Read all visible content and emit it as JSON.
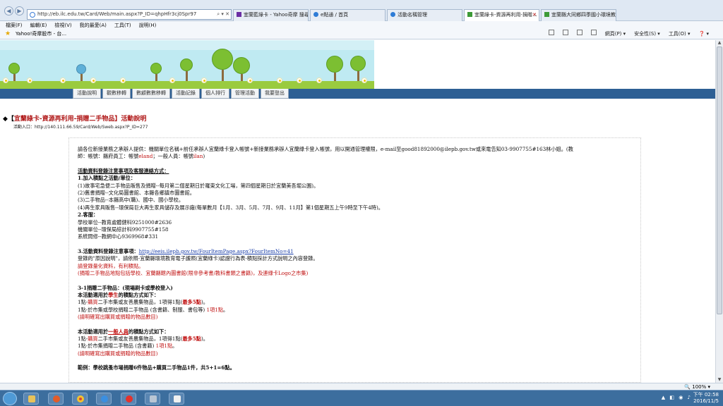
{
  "browser": {
    "url": "http://eb.ilc.edu.tw/Card/Web/main.aspx?P_ID=qhpHfr3cj0Spr97",
    "tabs": [
      {
        "label": "宜蘭藍綠卡 - Yahoo奇摩 搜尋...",
        "active": false
      },
      {
        "label": "e點通 / 首頁",
        "active": false
      },
      {
        "label": "活動名稱管理",
        "active": false
      },
      {
        "label": "宜蘭綠卡-資源再利用-捐贈...",
        "active": true
      },
      {
        "label": "宜蘭縣大同鄉四季國小環境教...",
        "active": false
      }
    ],
    "menu": [
      "檔案(F)",
      "編輯(E)",
      "檢視(V)",
      "我的最愛(A)",
      "工具(T)",
      "說明(H)"
    ],
    "favorites_link": "Yahoo!奇摩股市 - 台...",
    "command_bar": [
      "網頁(P) ▾",
      "安全性(S) ▾",
      "工具(O) ▾",
      "❓ ▾"
    ],
    "zoom": "🔍 100% ▾"
  },
  "site_nav": [
    "活動說明",
    "觀數移轉",
    "數顧數數移轉",
    "活動記錄",
    "個人排行",
    "管理活動",
    "我要登出"
  ],
  "page": {
    "heading_prefix": "◆【",
    "heading_title": "宜蘭綠卡-資源再利用-捐贈二手物品",
    "heading_suffix": "】活動說明",
    "entry": "活動入口：http://140.111.66.59/Card/Web/Sweb.aspx?P_ID=277",
    "intro_1": "請各位新接業務之承辦人提供：機關單位名稱+前任承辦人宜蘭綠卡登入帳號+新接業務承辦人宜蘭綠卡登入帳號，用以開通管理權限，e-mail至good81892000@ilepb.gov.tw或來電告知03-9907755#163林小姐。(教",
    "intro_2a": "師：帳號：縣府員工：帳號",
    "intro_2b": "eland",
    "intro_2c": "；一般人員：帳號",
    "intro_2d": "ilan",
    "intro_2e": ")",
    "reg_title": "活動資料登錄注意事項及客服連絡方式：",
    "s1_title": "1.加入積點之活動/單位：",
    "s1_items": [
      "(1)故事宅急便二手物品販售及捐贈--每月第二個星期日於羅東文化工場，第四個星期日於宜蘭美吾堀公園)。",
      "(2)舊書捐贈--文化局圖書館、本縣各鄉鎮市圖書館。",
      "(3)二手物品--本縣高中(職)、國中、國小學校。",
      "(4)再生家具販售--環保局巨大再生家具儲存及展示廠(每單數月【1月、3月、5月、7月、9月、11月】第1個星期五上午9時至下午4時)。"
    ],
    "s2_title": "2.客服：",
    "s2_items": [
      "學校單位--教育處體健科9251000#2636",
      "機關單位--環保局綜計科9907755#158",
      "系統問修--教網中心9369968#331"
    ],
    "s3_title": "3.活動資料登錄注意事項：",
    "s3_link": "http://eeis.ilepb.gov.tw/FourItemPage.aspx?FourItemNo=41",
    "s3_line1": "登錄的\"原因說明\"，請依照-宜蘭縣環境教育電子護照(宜蘭綠卡)認證行為表-積點採計方式說明之內容登錄。",
    "s3_line2": "請登錄量化資料，有利積點。",
    "s3_line3": "(捐贈二手物品地點包括學校、宜蘭縣轄內圖書館(限非參考書/教科書類之書籍)，及連綠卡Logo之市集)",
    "s31_title": "3-1捐贈二手物品：(現場刷卡或學校登入)",
    "student_a": "本活動適用於",
    "student_b": "學生",
    "student_c": "的積點方式如下：",
    "st1_a": "1點-",
    "st1_b": "購買",
    "st1_c": "二手市集或友善農集物品，1項得1點(",
    "st1_d": "最多5點",
    "st1_e": ")。",
    "st2_a": "1點-於市集或學校捐贈二手物品 (含書籍、制服、書包等) ",
    "st2_b": "1項1點",
    "st2_c": "。",
    "st_note": "(請明確寫出購買或捐贈的物品數目)",
    "general_a": "本活動適用於",
    "general_b": "一般人員",
    "general_c": "的積點方式如下：",
    "g1_a": "1點-",
    "g1_b": "購買",
    "g1_c": "二手市集或友善農集物品，1項得1點(",
    "g1_d": "最多5點",
    "g1_e": ")。",
    "g2_a": "1點-於市集捐贈二手物品 (含書籍) ",
    "g2_b": "1項1點",
    "g2_c": "。",
    "g_note": "(請明確寫出購買或捐贈的物品數目)",
    "example": "範例：學校跳蚤市場捐贈6件物品+購買二手物品1件，共5+1=6點。"
  },
  "clock": {
    "time": "下午 02:58",
    "date": "2016/11/5"
  },
  "colors": {
    "accent_red": "#c01010",
    "nav_blue": "#2d5f94",
    "link_blue": "#1a3ea8"
  }
}
